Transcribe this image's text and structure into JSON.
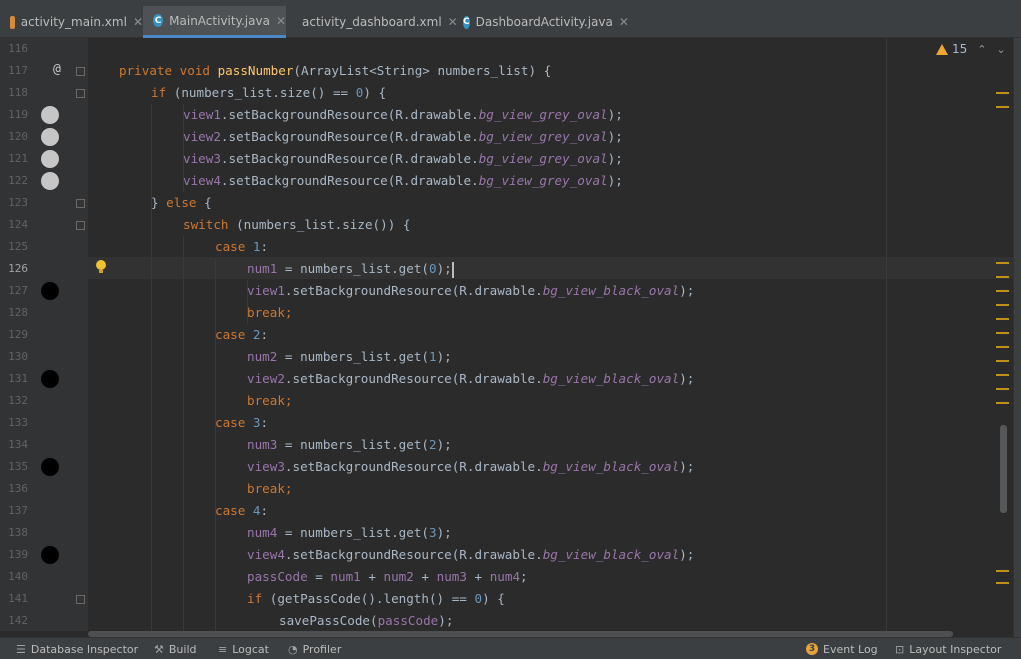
{
  "tabs": [
    {
      "label": "activity_main.xml",
      "type": "xml",
      "active": false
    },
    {
      "label": "MainActivity.java",
      "type": "java",
      "active": true
    },
    {
      "label": "activity_dashboard.xml",
      "type": "xml",
      "active": false
    },
    {
      "label": "DashboardActivity.java",
      "type": "java",
      "active": false
    }
  ],
  "close_glyph": "✕",
  "inspection": {
    "warning_count": "15",
    "up": "⌃",
    "down": "⌄"
  },
  "line_numbers": [
    "116",
    "117",
    "118",
    "119",
    "120",
    "121",
    "122",
    "123",
    "124",
    "125",
    "126",
    "127",
    "128",
    "129",
    "130",
    "131",
    "132",
    "133",
    "134",
    "135",
    "136",
    "137",
    "138",
    "139",
    "140",
    "141",
    "142"
  ],
  "current_line": "126",
  "code": {
    "l117": {
      "kw1": "private void ",
      "name": "passNumber",
      "rest": "(ArrayList<String> numbers_list) {"
    },
    "l118": {
      "kw": "if ",
      "rest": "(numbers_list.size() == ",
      "num": "0",
      "end": ") {"
    },
    "l119": {
      "obj": "view1",
      "call": ".setBackgroundResource(R.drawable.",
      "res": "bg_view_grey_oval",
      "end": ");"
    },
    "l120": {
      "obj": "view2",
      "call": ".setBackgroundResource(R.drawable.",
      "res": "bg_view_grey_oval",
      "end": ");"
    },
    "l121": {
      "obj": "view3",
      "call": ".setBackgroundResource(R.drawable.",
      "res": "bg_view_grey_oval",
      "end": ");"
    },
    "l122": {
      "obj": "view4",
      "call": ".setBackgroundResource(R.drawable.",
      "res": "bg_view_grey_oval",
      "end": ");"
    },
    "l123": {
      "brace": "} ",
      "kw": "else",
      "end": " {"
    },
    "l124": {
      "kw": "switch ",
      "rest": "(numbers_list.size()) {"
    },
    "l125": {
      "kw": "case ",
      "num": "1",
      "end": ":"
    },
    "l126": {
      "fld": "num1",
      "rest": " = numbers_list.get(",
      "num": "0",
      "end": ");"
    },
    "l127": {
      "obj": "view1",
      "call": ".setBackgroundResource(R.drawable.",
      "res": "bg_view_black_oval",
      "end": ");"
    },
    "l128": {
      "kw": "break",
      "end": ";"
    },
    "l129": {
      "kw": "case ",
      "num": "2",
      "end": ":"
    },
    "l130": {
      "fld": "num2",
      "rest": " = numbers_list.get(",
      "num": "1",
      "end": ");"
    },
    "l131": {
      "obj": "view2",
      "call": ".setBackgroundResource(R.drawable.",
      "res": "bg_view_black_oval",
      "end": ");"
    },
    "l132": {
      "kw": "break",
      "end": ";"
    },
    "l133": {
      "kw": "case ",
      "num": "3",
      "end": ":"
    },
    "l134": {
      "fld": "num3",
      "rest": " = numbers_list.get(",
      "num": "2",
      "end": ");"
    },
    "l135": {
      "obj": "view3",
      "call": ".setBackgroundResource(R.drawable.",
      "res": "bg_view_black_oval",
      "end": ");"
    },
    "l136": {
      "kw": "break",
      "end": ";"
    },
    "l137": {
      "kw": "case ",
      "num": "4",
      "end": ":"
    },
    "l138": {
      "fld": "num4",
      "rest": " = numbers_list.get(",
      "num": "3",
      "end": ");"
    },
    "l139": {
      "obj": "view4",
      "call": ".setBackgroundResource(R.drawable.",
      "res": "bg_view_black_oval",
      "end": ");"
    },
    "l140": {
      "a": "passCode",
      "eq": " = ",
      "b": "num1",
      "p1": " + ",
      "c": "num2",
      "p2": " + ",
      "d": "num3",
      "p3": " + ",
      "e": "num4",
      "end": ";"
    },
    "l141": {
      "kw": "if ",
      "rest": "(getPassCode().length() == ",
      "num": "0",
      "end": ") {"
    },
    "l142": {
      "call": "savePassCode(",
      "fld": "passCode",
      "end": ");"
    }
  },
  "bottom_bar": {
    "database_inspector": "Database Inspector",
    "build": "Build",
    "logcat": "Logcat",
    "profiler": "Profiler",
    "event_log_count": "3",
    "event_log": "Event Log",
    "layout_inspector": "Layout Inspector"
  },
  "colors": {
    "keyword": "#cc7832",
    "method": "#ffc66d",
    "number": "#6897bb",
    "field": "#9876aa",
    "text": "#a9b7c6",
    "background": "#2b2b2b"
  }
}
